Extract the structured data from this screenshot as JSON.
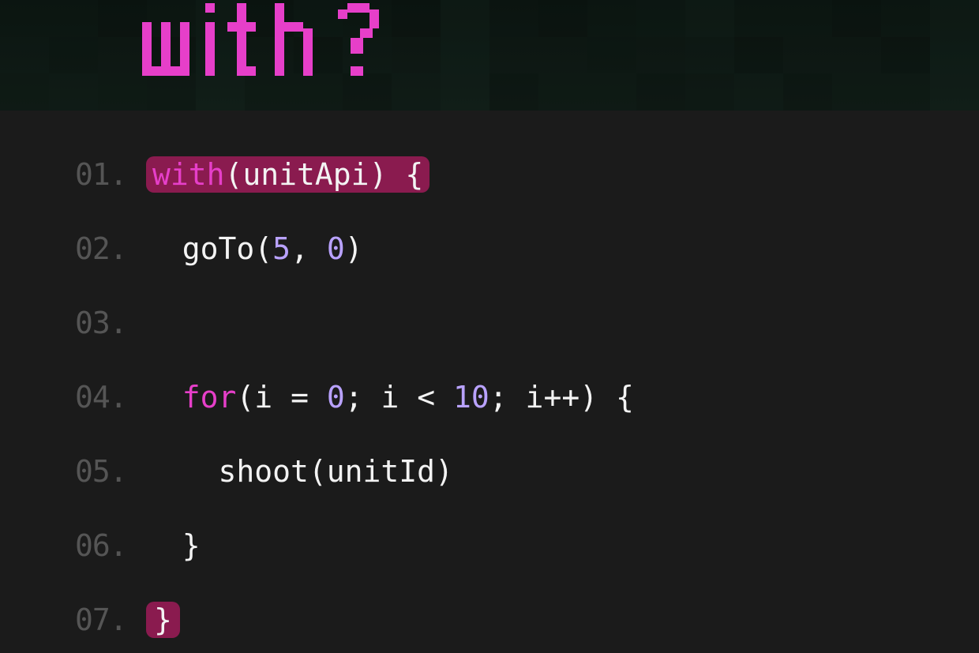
{
  "header": {
    "title_text": "with?"
  },
  "code": {
    "lines": [
      {
        "num": "01.",
        "highlight": true,
        "tokens": [
          {
            "t": "kw",
            "v": "with"
          },
          {
            "t": "punct",
            "v": "("
          },
          {
            "t": "ident",
            "v": "unitApi"
          },
          {
            "t": "punct",
            "v": ") {"
          }
        ]
      },
      {
        "num": "02.",
        "indent": "  ",
        "tokens": [
          {
            "t": "ident",
            "v": "goTo"
          },
          {
            "t": "punct",
            "v": "("
          },
          {
            "t": "numlit",
            "v": "5"
          },
          {
            "t": "punct",
            "v": ", "
          },
          {
            "t": "numlit",
            "v": "0"
          },
          {
            "t": "punct",
            "v": ")"
          }
        ]
      },
      {
        "num": "03.",
        "tokens": []
      },
      {
        "num": "04.",
        "indent": "  ",
        "tokens": [
          {
            "t": "kw",
            "v": "for"
          },
          {
            "t": "punct",
            "v": "("
          },
          {
            "t": "ident",
            "v": "i"
          },
          {
            "t": "punct",
            "v": " = "
          },
          {
            "t": "numlit",
            "v": "0"
          },
          {
            "t": "punct",
            "v": "; "
          },
          {
            "t": "ident",
            "v": "i"
          },
          {
            "t": "punct",
            "v": " < "
          },
          {
            "t": "numlit",
            "v": "10"
          },
          {
            "t": "punct",
            "v": "; "
          },
          {
            "t": "ident",
            "v": "i"
          },
          {
            "t": "punct",
            "v": "++) {"
          }
        ]
      },
      {
        "num": "05.",
        "indent": "    ",
        "tokens": [
          {
            "t": "ident",
            "v": "shoot"
          },
          {
            "t": "punct",
            "v": "("
          },
          {
            "t": "ident",
            "v": "unitId"
          },
          {
            "t": "punct",
            "v": ")"
          }
        ]
      },
      {
        "num": "06.",
        "indent": "  ",
        "tokens": [
          {
            "t": "punct",
            "v": "}"
          }
        ]
      },
      {
        "num": "07.",
        "highlight_tight": true,
        "tokens": [
          {
            "t": "punct",
            "v": "}"
          }
        ]
      }
    ]
  }
}
